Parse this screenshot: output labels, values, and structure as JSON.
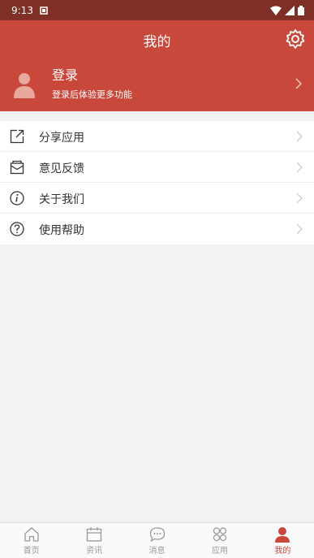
{
  "status_bar": {
    "time": "9:13"
  },
  "header": {
    "title": "我的"
  },
  "profile": {
    "title": "登录",
    "subtitle": "登录后体验更多功能"
  },
  "menu": [
    {
      "label": "分享应用",
      "icon": "share-icon"
    },
    {
      "label": "意见反馈",
      "icon": "feedback-icon"
    },
    {
      "label": "关于我们",
      "icon": "info-icon"
    },
    {
      "label": "使用帮助",
      "icon": "help-icon"
    }
  ],
  "tabs": [
    {
      "label": "首页",
      "icon": "home-icon"
    },
    {
      "label": "资讯",
      "icon": "calendar-icon"
    },
    {
      "label": "消息",
      "icon": "chat-icon"
    },
    {
      "label": "应用",
      "icon": "apps-icon"
    },
    {
      "label": "我的",
      "icon": "user-icon",
      "active": true
    }
  ],
  "colors": {
    "accent": "#c8483c",
    "status_bar": "#7e2f26"
  }
}
